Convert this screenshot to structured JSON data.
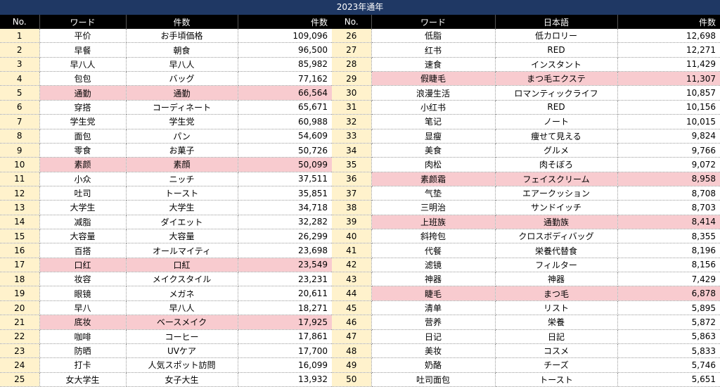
{
  "title": "2023年通年",
  "headers_left": {
    "no": "No.",
    "word": "ワード",
    "jp": "件数",
    "count": "件数"
  },
  "headers_right": {
    "no": "No.",
    "word": "ワード",
    "jp": "日本語",
    "count": "件数"
  },
  "highlight_color": "#f8cbcf",
  "left_rows": [
    {
      "no": "1",
      "word": "平价",
      "jp": "お手頃価格",
      "count": "109,096",
      "hl": false
    },
    {
      "no": "2",
      "word": "早餐",
      "jp": "朝食",
      "count": "96,500",
      "hl": false
    },
    {
      "no": "3",
      "word": "早八人",
      "jp": "早八人",
      "count": "85,982",
      "hl": false
    },
    {
      "no": "4",
      "word": "包包",
      "jp": "バッグ",
      "count": "77,162",
      "hl": false
    },
    {
      "no": "5",
      "word": "通勤",
      "jp": "通勤",
      "count": "66,564",
      "hl": true
    },
    {
      "no": "6",
      "word": "穿搭",
      "jp": "コーディネート",
      "count": "65,671",
      "hl": false
    },
    {
      "no": "7",
      "word": "学生党",
      "jp": "学生党",
      "count": "60,988",
      "hl": false
    },
    {
      "no": "8",
      "word": "面包",
      "jp": "パン",
      "count": "54,609",
      "hl": false
    },
    {
      "no": "9",
      "word": "零食",
      "jp": "お菓子",
      "count": "50,726",
      "hl": false
    },
    {
      "no": "10",
      "word": "素颜",
      "jp": "素顔",
      "count": "50,099",
      "hl": true
    },
    {
      "no": "11",
      "word": "小众",
      "jp": "ニッチ",
      "count": "37,511",
      "hl": false
    },
    {
      "no": "12",
      "word": "吐司",
      "jp": "トースト",
      "count": "35,851",
      "hl": false
    },
    {
      "no": "13",
      "word": "大学生",
      "jp": "大学生",
      "count": "34,718",
      "hl": false
    },
    {
      "no": "14",
      "word": "减脂",
      "jp": "ダイエット",
      "count": "32,282",
      "hl": false
    },
    {
      "no": "15",
      "word": "大容量",
      "jp": "大容量",
      "count": "26,299",
      "hl": false
    },
    {
      "no": "16",
      "word": "百搭",
      "jp": "オールマイティ",
      "count": "23,698",
      "hl": false
    },
    {
      "no": "17",
      "word": "口红",
      "jp": "口紅",
      "count": "23,549",
      "hl": true
    },
    {
      "no": "18",
      "word": "妆容",
      "jp": "メイクスタイル",
      "count": "23,231",
      "hl": false
    },
    {
      "no": "19",
      "word": "眼镜",
      "jp": "メガネ",
      "count": "20,611",
      "hl": false
    },
    {
      "no": "20",
      "word": "早八",
      "jp": "早八人",
      "count": "18,271",
      "hl": false
    },
    {
      "no": "21",
      "word": "底妆",
      "jp": "ベースメイク",
      "count": "17,925",
      "hl": true
    },
    {
      "no": "22",
      "word": "咖啡",
      "jp": "コーヒー",
      "count": "17,861",
      "hl": false
    },
    {
      "no": "23",
      "word": "防晒",
      "jp": "UVケア",
      "count": "17,700",
      "hl": false
    },
    {
      "no": "24",
      "word": "打卡",
      "jp": "人気スポット訪問",
      "count": "16,099",
      "hl": false
    },
    {
      "no": "25",
      "word": "女大学生",
      "jp": "女子大生",
      "count": "13,932",
      "hl": false
    }
  ],
  "right_rows": [
    {
      "no": "26",
      "word": "低脂",
      "jp": "低カロリー",
      "count": "12,698",
      "hl": false
    },
    {
      "no": "27",
      "word": "红书",
      "jp": "RED",
      "count": "12,271",
      "hl": false
    },
    {
      "no": "28",
      "word": "速食",
      "jp": "インスタント",
      "count": "11,429",
      "hl": false
    },
    {
      "no": "29",
      "word": "假睫毛",
      "jp": "まつ毛エクステ",
      "count": "11,307",
      "hl": true
    },
    {
      "no": "30",
      "word": "浪漫生活",
      "jp": "ロマンティックライフ",
      "count": "10,857",
      "hl": false
    },
    {
      "no": "31",
      "word": "小红书",
      "jp": "RED",
      "count": "10,156",
      "hl": false
    },
    {
      "no": "32",
      "word": "笔记",
      "jp": "ノート",
      "count": "10,015",
      "hl": false
    },
    {
      "no": "33",
      "word": "显瘦",
      "jp": "痩せて見える",
      "count": "9,824",
      "hl": false
    },
    {
      "no": "34",
      "word": "美食",
      "jp": "グルメ",
      "count": "9,766",
      "hl": false
    },
    {
      "no": "35",
      "word": "肉松",
      "jp": "肉そぼろ",
      "count": "9,072",
      "hl": false
    },
    {
      "no": "36",
      "word": "素颜霜",
      "jp": "フェイスクリーム",
      "count": "8,958",
      "hl": true
    },
    {
      "no": "37",
      "word": "气垫",
      "jp": "エアークッション",
      "count": "8,708",
      "hl": false
    },
    {
      "no": "38",
      "word": "三明治",
      "jp": "サンドイッチ",
      "count": "8,703",
      "hl": false
    },
    {
      "no": "39",
      "word": "上班族",
      "jp": "通勤族",
      "count": "8,414",
      "hl": true
    },
    {
      "no": "40",
      "word": "斜挎包",
      "jp": "クロスボディバッグ",
      "count": "8,355",
      "hl": false
    },
    {
      "no": "41",
      "word": "代餐",
      "jp": "栄養代替食",
      "count": "8,196",
      "hl": false
    },
    {
      "no": "42",
      "word": "滤镜",
      "jp": "フィルター",
      "count": "8,156",
      "hl": false
    },
    {
      "no": "43",
      "word": "神器",
      "jp": "神器",
      "count": "7,429",
      "hl": false
    },
    {
      "no": "44",
      "word": "睫毛",
      "jp": "まつ毛",
      "count": "6,878",
      "hl": true
    },
    {
      "no": "45",
      "word": "清单",
      "jp": "リスト",
      "count": "5,895",
      "hl": false
    },
    {
      "no": "46",
      "word": "营养",
      "jp": "栄養",
      "count": "5,872",
      "hl": false
    },
    {
      "no": "47",
      "word": "日记",
      "jp": "日記",
      "count": "5,863",
      "hl": false
    },
    {
      "no": "48",
      "word": "美妆",
      "jp": "コスメ",
      "count": "5,833",
      "hl": false
    },
    {
      "no": "49",
      "word": "奶酪",
      "jp": "チーズ",
      "count": "5,746",
      "hl": false
    },
    {
      "no": "50",
      "word": "吐司面包",
      "jp": "トースト",
      "count": "5,651",
      "hl": false
    }
  ]
}
